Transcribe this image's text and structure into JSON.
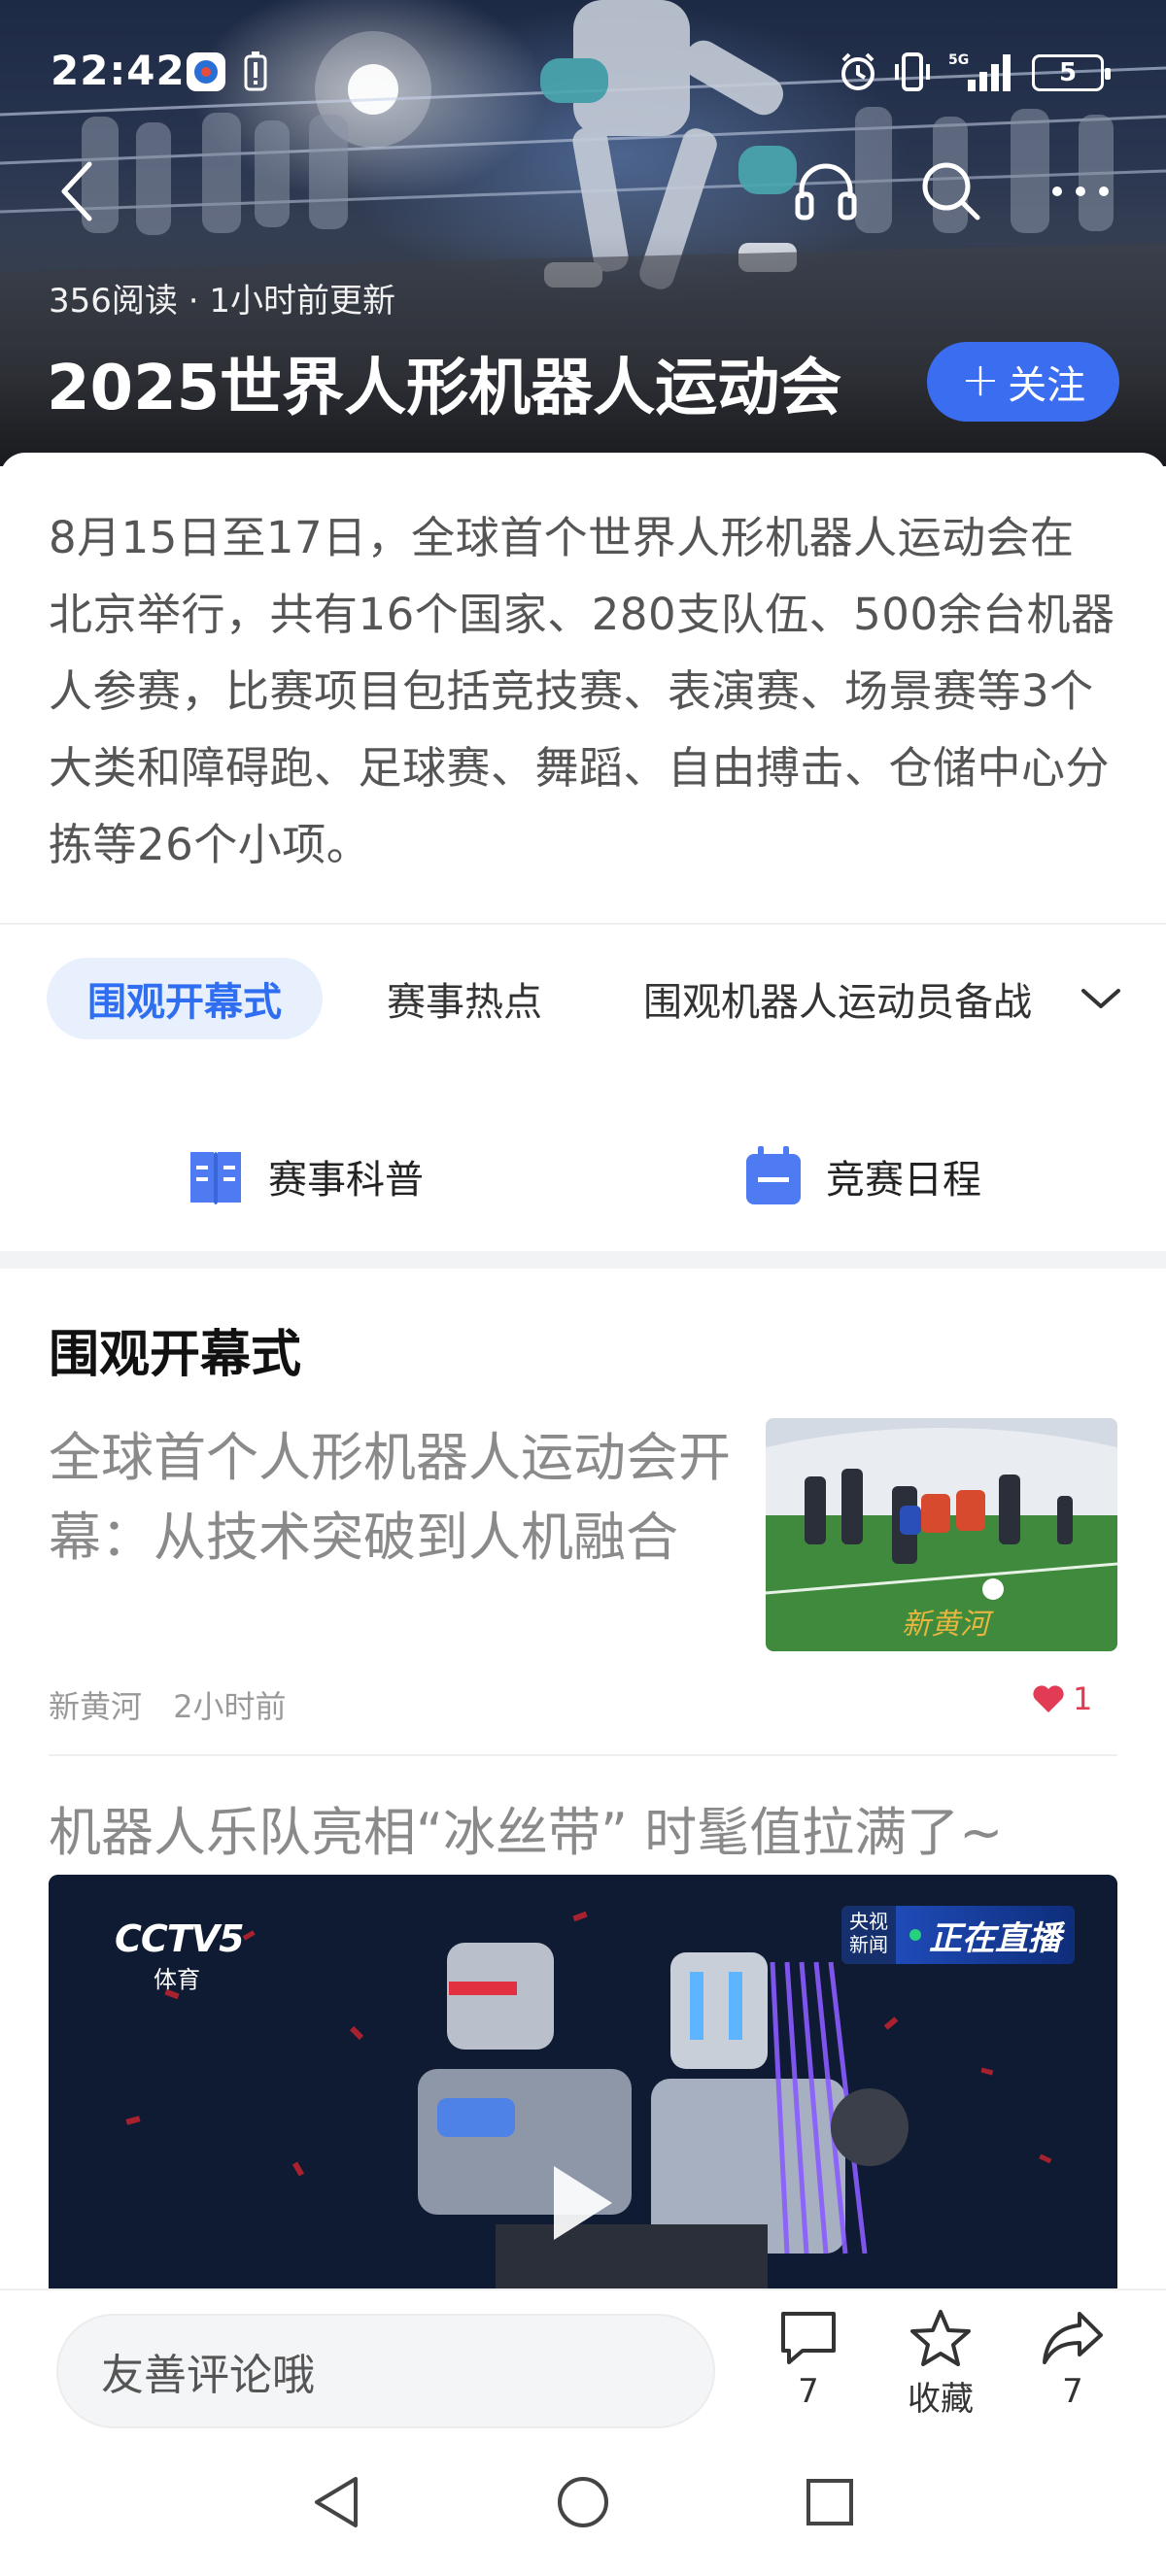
{
  "status_bar": {
    "time": "22:42",
    "battery": "5",
    "icons": [
      "cctv-app-icon",
      "battery-alert-icon",
      "alarm-icon",
      "vibrate-icon",
      "5g-signal-icon",
      "battery-icon"
    ]
  },
  "header": {
    "back_icon": "chevron-left-icon",
    "actions": [
      "headphones-icon",
      "search-icon",
      "more-icon"
    ]
  },
  "hero": {
    "meta": "356阅读 · 1小时前更新",
    "title": "2025世界人形机器人运动会",
    "follow_label": "关注"
  },
  "intro": {
    "text": "8月15日至17日，全球首个世界人形机器人运动会在北京举行，共有16个国家、280支队伍、500余台机器人参赛，比赛项目包括竞技赛、表演赛、场景赛等3个大类和障碍跑、足球赛、舞蹈、自由搏击、仓储中心分拣等26个小项。"
  },
  "tabs": {
    "items": [
      "围观开幕式",
      "赛事热点",
      "围观机器人运动员备战"
    ],
    "active_index": 0
  },
  "quick_links": [
    {
      "label": "赛事科普",
      "icon": "book-icon"
    },
    {
      "label": "竞赛日程",
      "icon": "calendar-icon"
    }
  ],
  "section": {
    "title": "围观开幕式"
  },
  "articles": [
    {
      "title": "全球首个人形机器人运动会开幕：从技术突破到人机融合",
      "source": "新黄河",
      "time": "2小时前",
      "likes": "1",
      "thumb_watermark": "新黄河"
    },
    {
      "title": "机器人乐队亮相“冰丝带” 时髦值拉满了~",
      "video": {
        "channel_logo": "CCTV5",
        "channel_sub": "体育",
        "badge_small": "央视新闻",
        "badge_live": "正在直播"
      }
    }
  ],
  "bottom_bar": {
    "comment_placeholder": "友善评论哦",
    "comment_count": "7",
    "favorite_label": "收藏",
    "share_count": "7"
  },
  "colors": {
    "accent": "#3a6df0",
    "tab_active_bg": "#e8f0fe",
    "like_red": "#e23b55"
  }
}
